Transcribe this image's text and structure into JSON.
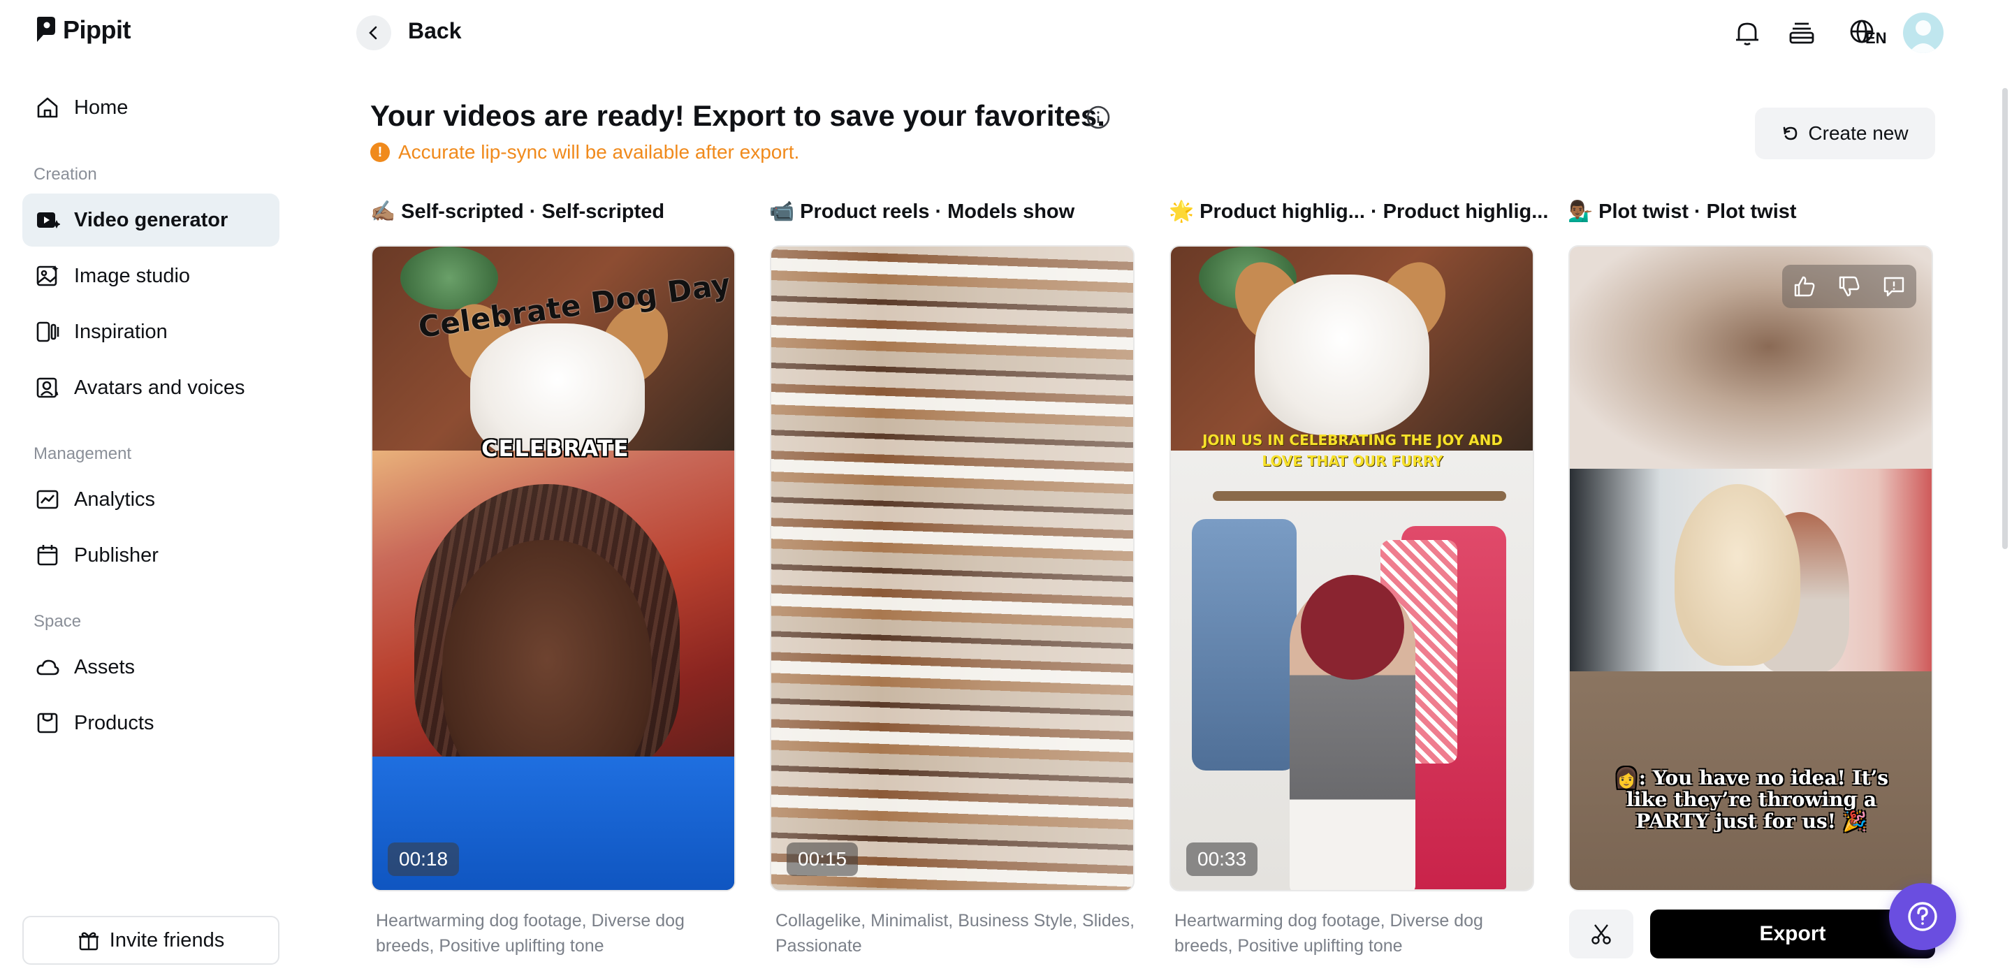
{
  "app": {
    "name": "Pippit"
  },
  "sidebar": {
    "items": [
      {
        "label": "Home",
        "icon": "home-icon"
      },
      {
        "label": "Video generator",
        "icon": "video-generator-icon",
        "active": true
      },
      {
        "label": "Image studio",
        "icon": "image-studio-icon"
      },
      {
        "label": "Inspiration",
        "icon": "inspiration-icon"
      },
      {
        "label": "Avatars and voices",
        "icon": "avatar-voice-icon"
      },
      {
        "label": "Analytics",
        "icon": "analytics-icon"
      },
      {
        "label": "Publisher",
        "icon": "calendar-icon"
      },
      {
        "label": "Assets",
        "icon": "cloud-icon"
      },
      {
        "label": "Products",
        "icon": "product-box-icon"
      }
    ],
    "sections": {
      "creation": "Creation",
      "management": "Management",
      "space": "Space"
    },
    "invite_label": "Invite friends"
  },
  "header": {
    "back_label": "Back",
    "language": "EN"
  },
  "main": {
    "title": "Your videos are ready! Export to save your favorites.",
    "notice": "Accurate lip-sync will be available after export.",
    "notice_mark": "!",
    "create_new_label": "Create new",
    "cards": [
      {
        "emoji": "✍🏽",
        "label_left": "Self-scripted",
        "separator": "·",
        "label_right": "Self-scripted",
        "duration": "00:18",
        "overlay_title": "Celebrate Dog Day",
        "overlay_sub": "CELEBRATE",
        "description": "Heartwarming dog footage, Diverse dog breeds, Positive uplifting tone"
      },
      {
        "emoji": "📹",
        "label_left": "Product reels",
        "separator": "·",
        "label_right": "Models show",
        "duration": "00:15",
        "description": "Collagelike, Minimalist, Business Style, Slides, Passionate"
      },
      {
        "emoji": "🌟",
        "label_left": "Product highlig...",
        "separator": "·",
        "label_right": "Product highlig...",
        "duration": "00:33",
        "overlay_caption": "JOIN US IN CELEBRATING THE JOY AND LOVE THAT OUR FURRY",
        "description": "Heartwarming dog footage, Diverse dog breeds, Positive uplifting tone"
      },
      {
        "emoji": "💁🏾‍♂️",
        "label_left": "Plot twist",
        "separator": "·",
        "label_right": "Plot twist",
        "overlay_caption": "👩: You have no idea! It’s like they’re throwing a PARTY just for us! 🎉"
      }
    ],
    "export_label": "Export"
  },
  "colors": {
    "accent_orange": "#f08a1c",
    "active_nav_bg": "#eaf0f4",
    "help_purple": "#6a4ee0",
    "export_bg": "#000000"
  }
}
